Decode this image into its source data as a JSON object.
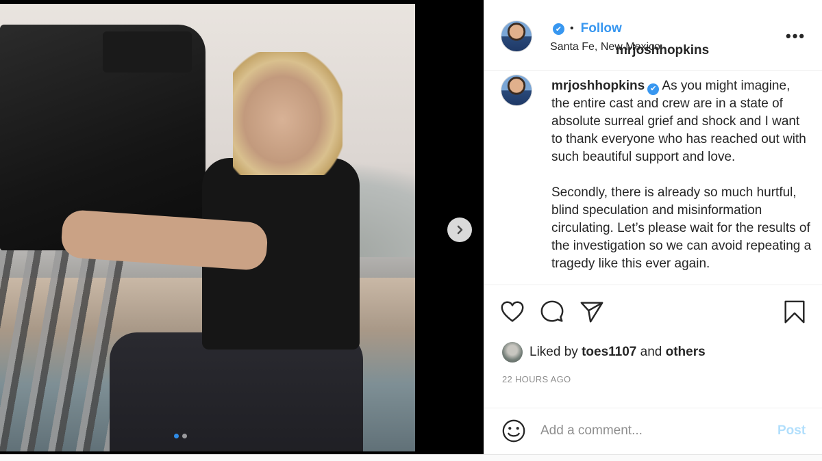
{
  "post": {
    "username": "mrjoshhopkins",
    "follow_label": "Follow",
    "location": "Santa Fe, New Mexico",
    "more_label": "•••",
    "dot_separator": "•",
    "verified_mark": "✔"
  },
  "caption": {
    "username": "mrjoshhopkins",
    "paragraph_1": "As you might imagine, the entire cast and crew are in a state of absolute surreal grief and shock and I want to thank everyone who has reached out with such beautiful support and love.",
    "paragraph_2": "Secondly, there is already so much hurtful, blind speculation and misinformation circulating. Let’s please wait for the results of the investigation so we can avoid repeating a tragedy like this ever again."
  },
  "likes": {
    "prefix": "Liked by",
    "user": "toes1107",
    "conjunction": "and",
    "others": "others"
  },
  "timestamp": "22 HOURS AGO",
  "comment": {
    "placeholder": "Add a comment...",
    "post_label": "Post"
  },
  "carousel": {
    "total_slides": 2,
    "active_slide": 1
  },
  "icons": {
    "like": "heart-icon",
    "comment": "comment-icon",
    "share": "send-icon",
    "save": "bookmark-icon",
    "emoji": "emoji-icon",
    "next": "chevron-right-icon"
  },
  "colors": {
    "accent": "#3897f0",
    "post_disabled": "#b2dffc",
    "muted": "#8e8e8e"
  }
}
